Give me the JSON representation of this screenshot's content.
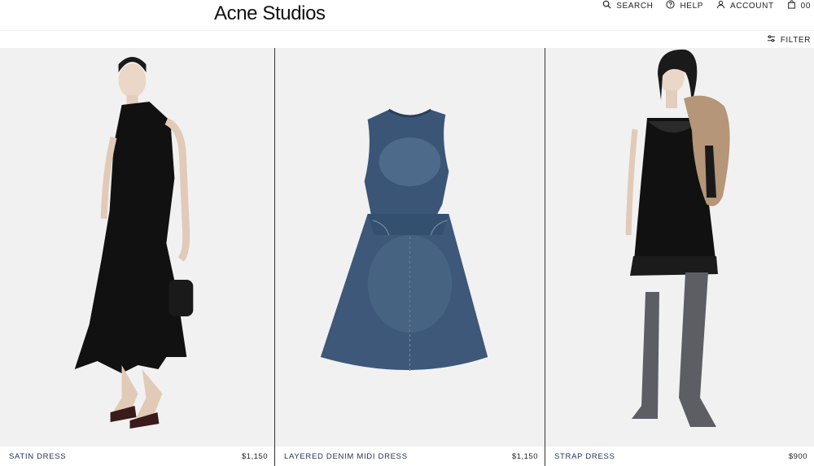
{
  "brand": {
    "logo": "Acne Studios"
  },
  "nav": {
    "search_label": "SEARCH",
    "help_label": "HELP",
    "account_label": "ACCOUNT",
    "cart_count": "00"
  },
  "toolbar": {
    "filter_label": "FILTER"
  },
  "products": [
    {
      "name": "SATIN DRESS",
      "price": "$1,150"
    },
    {
      "name": "LAYERED DENIM MIDI DRESS",
      "price": "$1,150"
    },
    {
      "name": "STRAP DRESS",
      "price": "$900"
    }
  ],
  "icons": {
    "search": "search-icon",
    "help": "help-icon",
    "account": "account-icon",
    "cart": "bag-icon",
    "filter": "filter-icon"
  },
  "colors": {
    "product_name": "#1f2d5a",
    "photo_background": "#f1f1f1",
    "denim": "#3b5577"
  }
}
